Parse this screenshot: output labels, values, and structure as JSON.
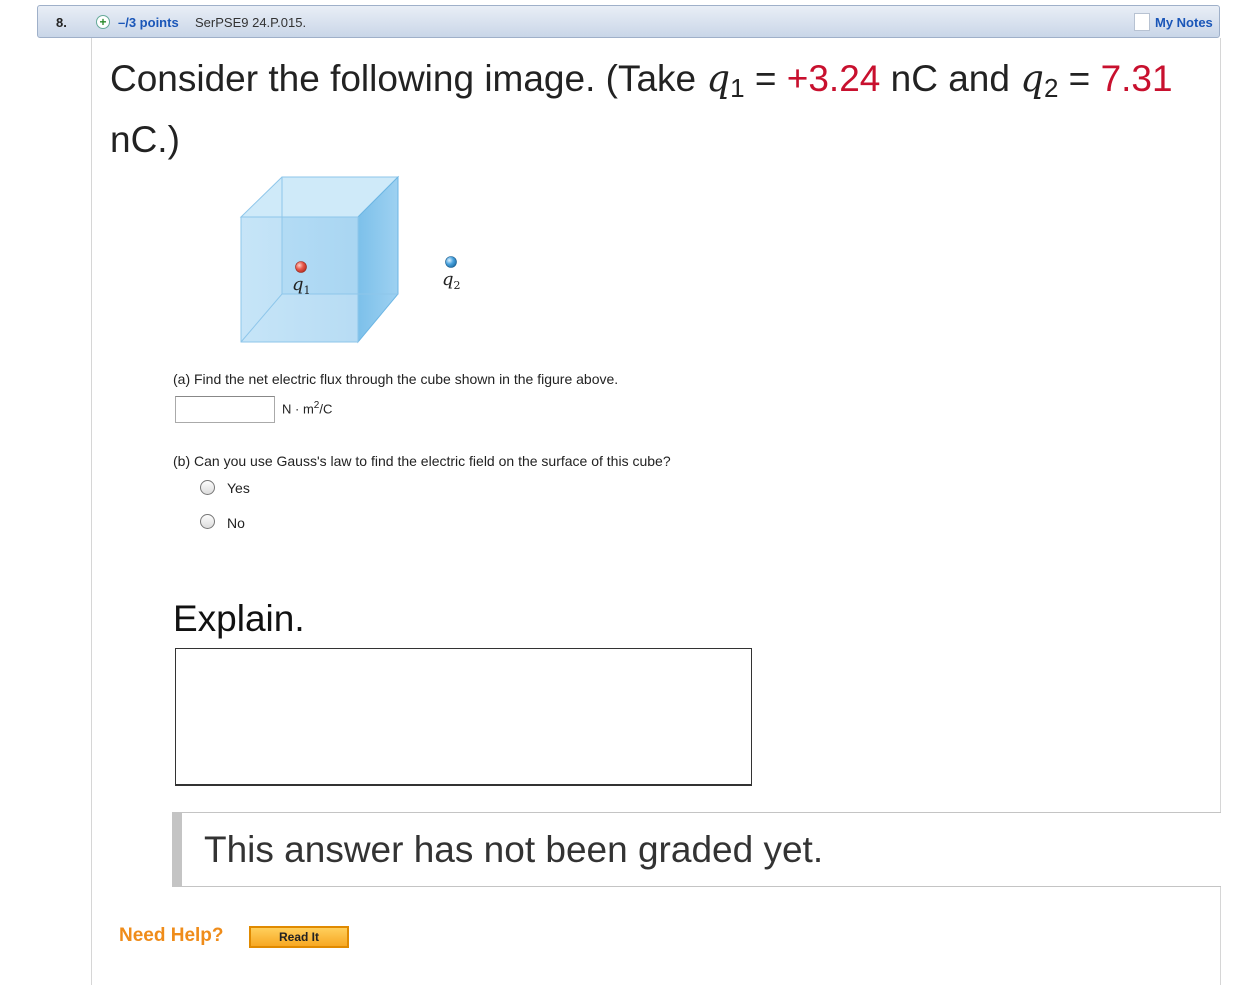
{
  "header": {
    "question_number": "8.",
    "plus_symbol": "+",
    "points": "–/3 points",
    "question_id": "SerPSE9 24.P.015.",
    "notes_label": "My Notes",
    "notes_icon": "document-icon"
  },
  "prompt": {
    "lead": "Consider the following image. (Take ",
    "q1_symbol": "q",
    "q1_sub": "1",
    "eq1": " = ",
    "q1_value": "+3.24",
    "mid": " nC and ",
    "q2_symbol": "q",
    "q2_sub": "2",
    "eq2": " = ",
    "q2_value": "7.31",
    "tail": " nC.)"
  },
  "figure": {
    "q1_label": "q",
    "q1_sub": "1",
    "q2_label": "q",
    "q2_sub": "2",
    "colors": {
      "cube": "#a9d5f2",
      "q1_charge": "#e8584a",
      "q2_charge": "#4aa3de"
    }
  },
  "part_a": {
    "question": "(a) Find the net electric flux through the cube shown in the figure above.",
    "input_value": "",
    "unit_prefix": "N · m",
    "unit_sup": "2",
    "unit_suffix": "/C"
  },
  "part_b": {
    "question": "(b) Can you use Gauss's law to find the electric field on the surface of this cube?",
    "options": [
      "Yes",
      "No"
    ],
    "selected": null
  },
  "explain": {
    "label": "Explain.",
    "value": ""
  },
  "grading": {
    "status": "This answer has not been graded yet."
  },
  "help": {
    "label": "Need Help?",
    "read_it": "Read It"
  }
}
